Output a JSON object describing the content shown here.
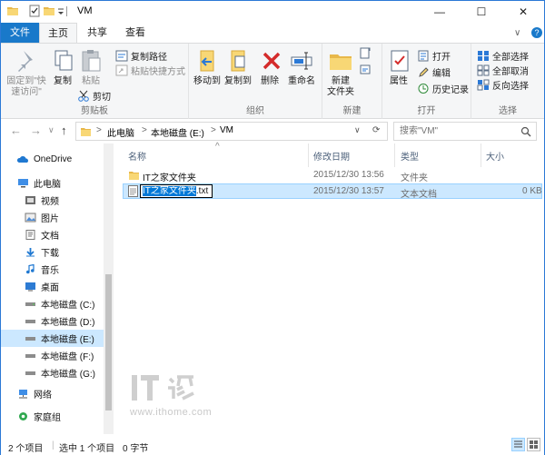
{
  "window": {
    "title": "VM",
    "minimize_glyph": "—",
    "maximize_glyph": "☐",
    "close_glyph": "✕"
  },
  "ribbon_tabs": {
    "file": "文件",
    "home": "主页",
    "share": "共享",
    "view": "查看",
    "expand_glyph": "∨",
    "help_glyph": "?"
  },
  "ribbon": {
    "clipboard": {
      "label": "剪贴板",
      "pin_line1": "固定到\"快",
      "pin_line2": "速访问\"",
      "copy": "复制",
      "paste": "粘贴",
      "copy_path": "复制路径",
      "paste_shortcut": "粘贴快捷方式",
      "cut": "剪切"
    },
    "organize": {
      "label": "组织",
      "move_to": "移动到",
      "copy_to": "复制到",
      "delete": "删除",
      "rename": "重命名"
    },
    "new": {
      "label": "新建",
      "new_folder_line1": "新建",
      "new_folder_line2": "文件夹"
    },
    "open": {
      "label": "打开",
      "properties": "属性",
      "open": "打开",
      "edit": "编辑",
      "history": "历史记录"
    },
    "select": {
      "label": "选择",
      "select_all": "全部选择",
      "select_none": "全部取消",
      "invert": "反向选择"
    }
  },
  "address": {
    "back": "←",
    "forward": "→",
    "up": "↑",
    "crumbs": [
      "此电脑",
      "本地磁盘 (E:)",
      "VM"
    ],
    "separator": ">",
    "search_placeholder": "搜索\"VM\""
  },
  "nav": {
    "items": [
      {
        "label": "OneDrive",
        "icon": "onedrive-icon"
      },
      {
        "label": "此电脑",
        "icon": "computer-icon"
      },
      {
        "label": "视频",
        "icon": "video-icon"
      },
      {
        "label": "图片",
        "icon": "pictures-icon"
      },
      {
        "label": "文档",
        "icon": "documents-icon"
      },
      {
        "label": "下载",
        "icon": "downloads-icon"
      },
      {
        "label": "音乐",
        "icon": "music-icon"
      },
      {
        "label": "桌面",
        "icon": "desktop-icon"
      },
      {
        "label": "本地磁盘 (C:)",
        "icon": "drive-icon"
      },
      {
        "label": "本地磁盘 (D:)",
        "icon": "drive-icon"
      },
      {
        "label": "本地磁盘 (E:)",
        "icon": "drive-icon"
      },
      {
        "label": "本地磁盘 (F:)",
        "icon": "drive-icon"
      },
      {
        "label": "本地磁盘 (G:)",
        "icon": "drive-icon"
      },
      {
        "label": "网络",
        "icon": "network-icon"
      },
      {
        "label": "家庭组",
        "icon": "homegroup-icon"
      }
    ]
  },
  "columns": {
    "name": "名称",
    "date": "修改日期",
    "type": "类型",
    "size": "大小",
    "sort_glyph": "^"
  },
  "files": [
    {
      "name": "IT之家文件夹",
      "date": "2015/12/30 13:56",
      "type": "文件夹",
      "size": ""
    },
    {
      "name": "IT之家文件夹.txt",
      "date": "2015/12/30 13:57",
      "type": "文本文档",
      "size": "0 KB"
    }
  ],
  "rename_edit": {
    "selected_part": "IT之家文件夹",
    "rest": ".txt"
  },
  "watermark": {
    "url": "www.ithome.com"
  },
  "status": {
    "count": "2 个项目",
    "selection": "选中 1 个项目",
    "size": "0 字节"
  }
}
